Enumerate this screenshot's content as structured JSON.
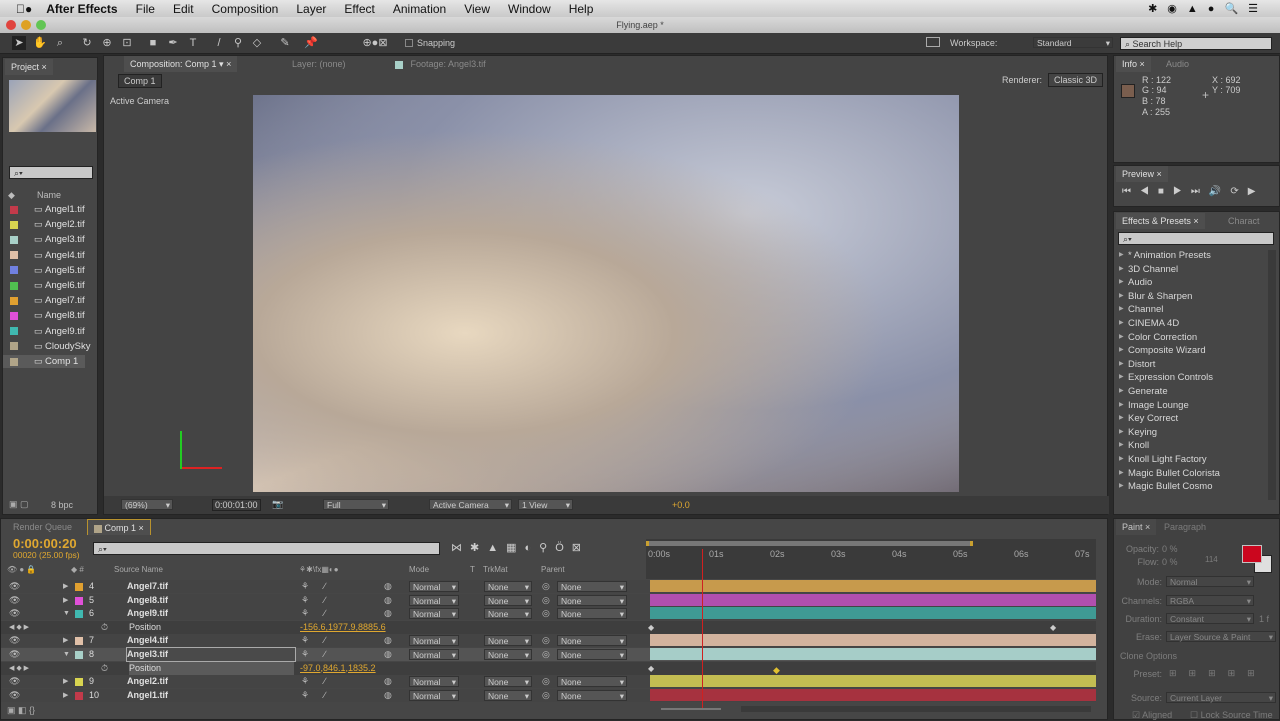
{
  "menubar": {
    "app": "After Effects",
    "items": [
      "File",
      "Edit",
      "Composition",
      "Layer",
      "Effect",
      "Animation",
      "View",
      "Window",
      "Help"
    ]
  },
  "window": {
    "title": "Flying.aep *"
  },
  "toolbar": {
    "snapping": "Snapping",
    "workspace_label": "Workspace:",
    "workspace": "Standard",
    "search_help": "Search Help"
  },
  "project": {
    "tab": "Project",
    "col_name": "Name",
    "items": [
      {
        "name": "Angel1.tif",
        "color": "#c23a4a"
      },
      {
        "name": "Angel2.tif",
        "color": "#d8d450"
      },
      {
        "name": "Angel3.tif",
        "color": "#a8d0c8"
      },
      {
        "name": "Angel4.tif",
        "color": "#e0c0a8"
      },
      {
        "name": "Angel5.tif",
        "color": "#7080e0"
      },
      {
        "name": "Angel6.tif",
        "color": "#50c050"
      },
      {
        "name": "Angel7.tif",
        "color": "#e0a030"
      },
      {
        "name": "Angel8.tif",
        "color": "#e050d8"
      },
      {
        "name": "Angel9.tif",
        "color": "#40b8b0"
      },
      {
        "name": "CloudySky",
        "color": "#b0a488"
      },
      {
        "name": "Comp 1",
        "color": "#b0a488"
      }
    ],
    "bpc": "8 bpc"
  },
  "composition": {
    "tab": "Composition: Comp 1",
    "layer_tab": "Layer: (none)",
    "footage_tab": "Footage: Angel3.tif",
    "breadcrumb": "Comp 1",
    "renderer_label": "Renderer:",
    "renderer": "Classic 3D",
    "camera_label": "Active Camera",
    "footer": {
      "zoom": "(69%)",
      "time": "0:00:01:00",
      "resolution": "Full",
      "camera": "Active Camera",
      "views": "1 View",
      "exposure": "+0.0"
    }
  },
  "info": {
    "tab": "Info",
    "audio_tab": "Audio",
    "r": "R : 122",
    "g": "G : 94",
    "b": "B : 78",
    "a": "A : 255",
    "x": "X : 692",
    "y": "Y : 709",
    "swatch": "#7a5e4e"
  },
  "preview": {
    "tab": "Preview"
  },
  "effects": {
    "tab": "Effects & Presets",
    "char_tab": "Charact",
    "items": [
      "* Animation Presets",
      "3D Channel",
      "Audio",
      "Blur & Sharpen",
      "Channel",
      "CINEMA 4D",
      "Color Correction",
      "Composite Wizard",
      "Distort",
      "Expression Controls",
      "Generate",
      "Image Lounge",
      "Key Correct",
      "Keying",
      "Knoll",
      "Knoll Light Factory",
      "Magic Bullet Colorista",
      "Magic Bullet Cosmo"
    ]
  },
  "timeline": {
    "render_tab": "Render Queue",
    "comp_tab": "Comp 1",
    "timecode": "0:00:00:20",
    "frames": "00020 (25.00 fps)",
    "headers": {
      "source": "Source Name",
      "mode": "Mode",
      "t": "T",
      "trkmat": "TrkMat",
      "parent": "Parent"
    },
    "ruler": [
      "0:00s",
      "01s",
      "02s",
      "03s",
      "04s",
      "05s",
      "06s",
      "07s"
    ],
    "layers": [
      {
        "num": "4",
        "name": "Angel7.tif",
        "color": "#e0a030",
        "mode": "Normal",
        "trkmat": "None",
        "parent": "None",
        "bar": "#c79a4c"
      },
      {
        "num": "5",
        "name": "Angel8.tif",
        "color": "#e050d8",
        "mode": "Normal",
        "trkmat": "None",
        "parent": "None",
        "bar": "#b14fae"
      },
      {
        "num": "6",
        "name": "Angel9.tif",
        "color": "#40b8b0",
        "mode": "Normal",
        "trkmat": "None",
        "parent": "None",
        "bar": "#3f9a94",
        "prop": "Position",
        "value": "-156.6,1977.9,8885.6"
      },
      {
        "num": "7",
        "name": "Angel4.tif",
        "color": "#e0c0a8",
        "mode": "Normal",
        "trkmat": "None",
        "parent": "None",
        "bar": "#d2b39e"
      },
      {
        "num": "8",
        "name": "Angel3.tif",
        "color": "#a8d0c8",
        "mode": "Normal",
        "trkmat": "None",
        "parent": "None",
        "bar": "#a6cdc8",
        "prop": "Position",
        "value": "-97.0,846.1,1835.2"
      },
      {
        "num": "9",
        "name": "Angel2.tif",
        "color": "#d8d450",
        "mode": "Normal",
        "trkmat": "None",
        "parent": "None",
        "bar": "#c3bd52"
      },
      {
        "num": "10",
        "name": "Angel1.tif",
        "color": "#c23a4a",
        "mode": "Normal",
        "trkmat": "None",
        "parent": "None",
        "bar": "#a6323f"
      }
    ],
    "playhead_seconds": 0.8
  },
  "paint": {
    "tab": "Paint",
    "para_tab": "Paragraph",
    "opacity_label": "Opacity:",
    "opacity": "0 %",
    "flow_label": "Flow:",
    "flow": "0 %",
    "brush_size": "114",
    "mode_label": "Mode:",
    "mode": "Normal",
    "channels_label": "Channels:",
    "channels": "RGBA",
    "duration_label": "Duration:",
    "duration": "Constant",
    "duration_frames": "1 f",
    "erase_label": "Erase:",
    "erase": "Layer Source & Paint",
    "clone_options": "Clone Options",
    "preset_label": "Preset:",
    "source_label": "Source:",
    "source": "Current Layer",
    "aligned": "Aligned",
    "lock_source": "Lock Source Time",
    "fg": "#e8001c",
    "bg": "#ffffff"
  }
}
